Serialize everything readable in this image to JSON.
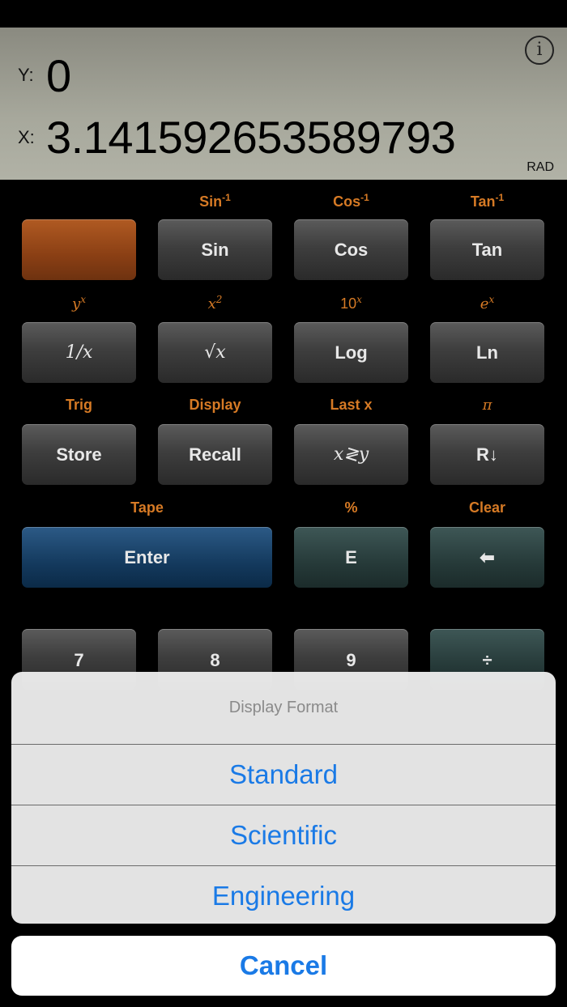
{
  "display": {
    "y_label": "Y:",
    "y_value": "0",
    "x_label": "X:",
    "x_value": "3.141592653589793",
    "angle_mode": "RAD",
    "info_glyph": "i"
  },
  "keys": {
    "row1": {
      "sec": [
        "",
        "Sin",
        "Cos",
        "Tan"
      ],
      "sec_sup": [
        "",
        "-1",
        "-1",
        "-1"
      ],
      "labels": [
        "",
        "Sin",
        "Cos",
        "Tan"
      ]
    },
    "row2": {
      "sec_base": [
        "y",
        "x",
        "10",
        "e"
      ],
      "sec_sup": [
        "x",
        "2",
        "x",
        "x"
      ],
      "labels": [
        "1/x",
        "√x",
        "Log",
        "Ln"
      ]
    },
    "row3": {
      "sec": [
        "Trig",
        "Display",
        "Last x",
        "π"
      ],
      "labels": [
        "Store",
        "Recall",
        "x≷y",
        "R↓"
      ]
    },
    "row4": {
      "sec": [
        "Tape",
        "%",
        "Clear"
      ],
      "labels": [
        "Enter",
        "E",
        "⬅"
      ]
    },
    "row5": {
      "labels": [
        "7",
        "8",
        "9",
        "÷"
      ]
    }
  },
  "colors": {
    "accent_orange": "#d67a25",
    "ios_blue": "#1a7ae6"
  },
  "action_sheet": {
    "title": "Display Format",
    "options": [
      "Standard",
      "Scientific",
      "Engineering"
    ],
    "cancel": "Cancel"
  }
}
